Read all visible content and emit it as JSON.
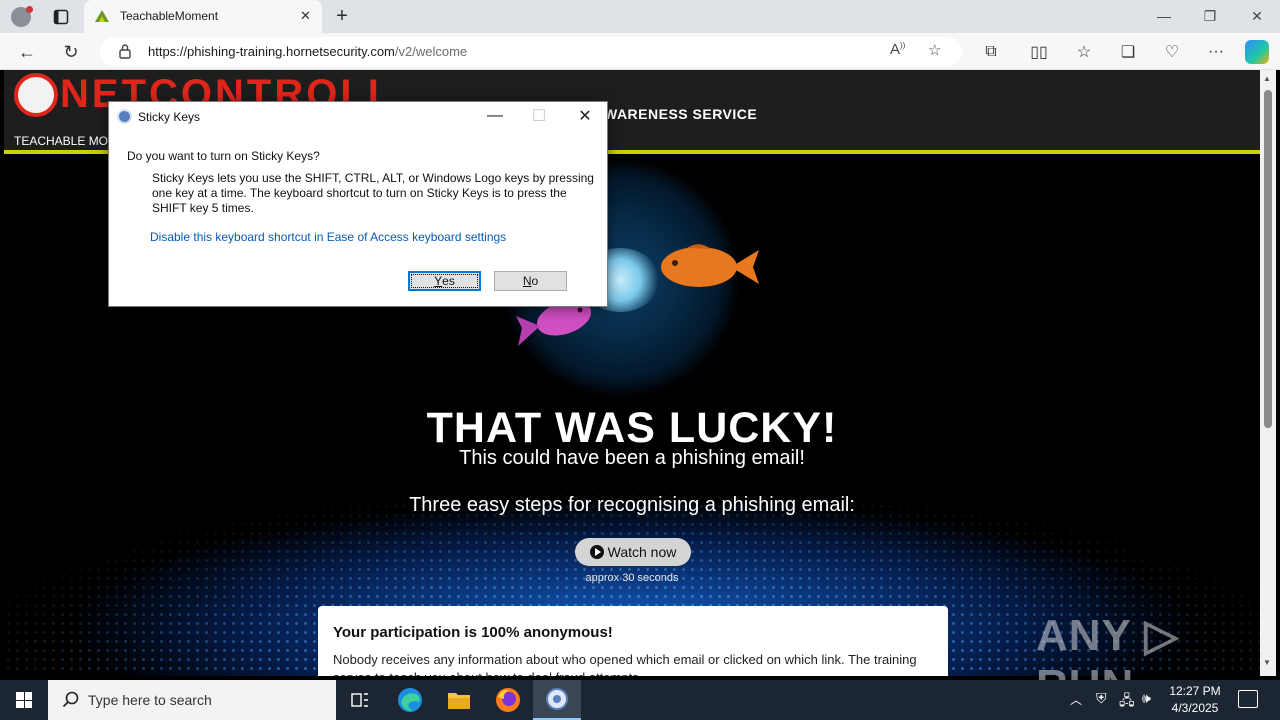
{
  "browser": {
    "tab_title": "TeachableMoment",
    "url_host": "https://phishing-training.hornetsecurity.com",
    "url_path": "/v2/welcome"
  },
  "site": {
    "logo_text": "NETCONTROLL",
    "header_service": "WARENESS SERVICE",
    "header_sub": "TEACHABLE MO"
  },
  "hero": {
    "headline": "THAT WAS LUCKY!",
    "subheadline": "This could have been a phishing email!",
    "steps_text": "Three easy steps for recognising a phishing email:",
    "watch_label": "Watch now",
    "watch_hint": "approx 30 seconds"
  },
  "anon_card": {
    "title": "Your participation is 100% anonymous!",
    "body": "Nobody receives any information about who opened which email or clicked on which link. The training serves to teach you about how to deal fraud attempts."
  },
  "watermark": "ANY ▷ RUN",
  "dialog": {
    "title": "Sticky Keys",
    "question": "Do you want to turn on Sticky Keys?",
    "description": "Sticky Keys lets you use the SHIFT, CTRL, ALT, or Windows Logo keys by pressing one key at a time. The keyboard shortcut to turn on Sticky Keys is to press the SHIFT key 5 times.",
    "link": "Disable this keyboard shortcut in Ease of Access keyboard settings",
    "yes_underlined": "Y",
    "yes_rest": "es",
    "no_underlined": "N",
    "no_rest": "o"
  },
  "taskbar": {
    "search_placeholder": "Type here to search",
    "time": "12:27 PM",
    "date": "4/3/2025"
  },
  "colors": {
    "brand_red": "#e0261b",
    "accent_lime": "#c8d200",
    "link_blue": "#0a59b5"
  }
}
